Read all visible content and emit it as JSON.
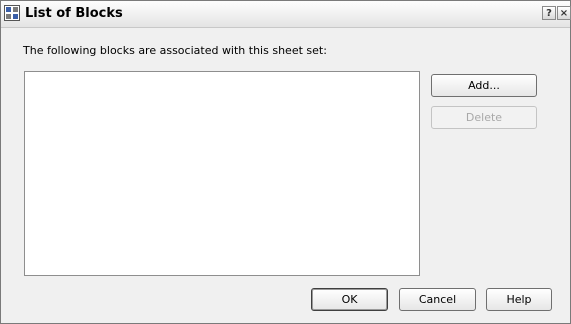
{
  "window": {
    "title": "List of Blocks",
    "help_glyph": "?",
    "close_glyph": "×"
  },
  "main": {
    "prompt": "The following blocks are associated with this sheet set:",
    "blocks": []
  },
  "buttons": {
    "add": "Add...",
    "delete": "Delete",
    "ok": "OK",
    "cancel": "Cancel",
    "help": "Help"
  }
}
